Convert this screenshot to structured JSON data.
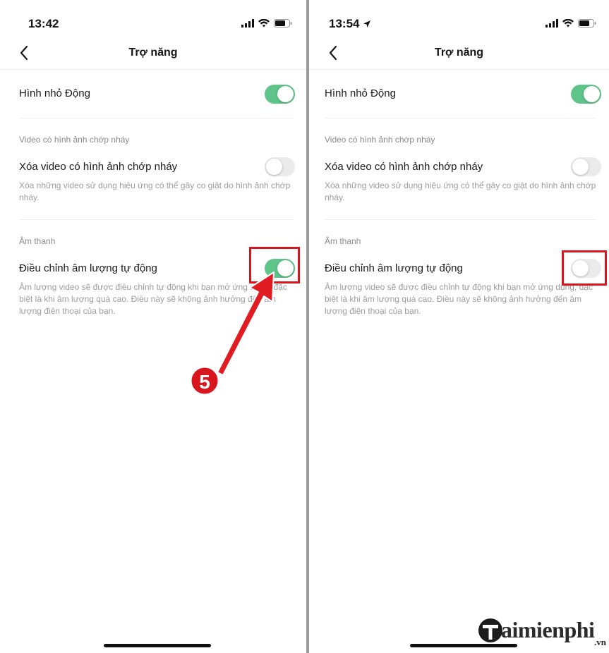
{
  "left_screen": {
    "status_time": "13:42",
    "title": "Trợ năng",
    "animated_thumbnail_label": "Hình nhỏ Động",
    "animated_thumbnail_on": true,
    "flashing_section_header": "Video có hình ảnh chớp nháy",
    "remove_flashing_label": "Xóa video có hình ảnh chớp nháy",
    "remove_flashing_on": false,
    "remove_flashing_desc": "Xóa những video sử dụng hiệu ứng có thể gây co giật do hình ảnh chớp nháy.",
    "sound_section_header": "Âm thanh",
    "auto_volume_label": "Điều chỉnh âm lượng tự động",
    "auto_volume_on": true,
    "auto_volume_desc": "Âm lượng video sẽ được điều chỉnh tự động khi bạn mở ứng dụng, đặc biệt là khi âm lượng quá cao. Điều này sẽ không ảnh hưởng đến âm lượng điện thoại của bạn."
  },
  "right_screen": {
    "status_time": "13:54",
    "title": "Trợ năng",
    "animated_thumbnail_label": "Hình nhỏ Động",
    "animated_thumbnail_on": true,
    "flashing_section_header": "Video có hình ảnh chớp nháy",
    "remove_flashing_label": "Xóa video có hình ảnh chớp nháy",
    "remove_flashing_on": false,
    "remove_flashing_desc": "Xóa những video sử dụng hiệu ứng có thể gây co giật do hình ảnh chớp nháy.",
    "sound_section_header": "Âm thanh",
    "auto_volume_label": "Điều chỉnh âm lượng tự động",
    "auto_volume_on": false,
    "auto_volume_desc": "Âm lượng video sẽ được điều chỉnh tự động khi bạn mở ứng dụng, đặc biệt là khi âm lượng quá cao. Điều này sẽ không ảnh hưởng đến âm lượng điện thoại của bạn."
  },
  "annotation": {
    "step_number": "5",
    "highlight_color": "#d8161d"
  },
  "colors": {
    "toggle_on": "#5ec489",
    "toggle_off": "#ebebeb"
  },
  "icons": [
    "back-chevron-icon",
    "signal-icon",
    "wifi-icon",
    "battery-icon",
    "location-arrow-icon",
    "taimienphi-logo-icon"
  ],
  "watermark": {
    "text": "aimienphi",
    "suffix": ".vn"
  }
}
